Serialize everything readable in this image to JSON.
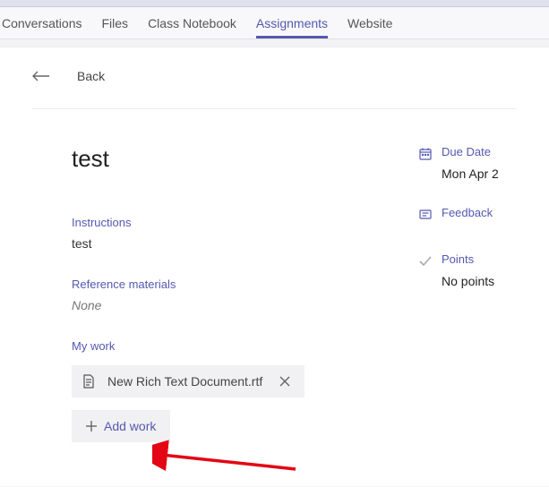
{
  "tabs": {
    "items": [
      {
        "label": "Conversations",
        "active": false
      },
      {
        "label": "Files",
        "active": false
      },
      {
        "label": "Class Notebook",
        "active": false
      },
      {
        "label": "Assignments",
        "active": true
      },
      {
        "label": "Website",
        "active": false
      }
    ]
  },
  "back": {
    "label": "Back"
  },
  "assignment": {
    "title": "test",
    "instructions_label": "Instructions",
    "instructions_value": "test",
    "reference_label": "Reference materials",
    "reference_value": "None",
    "mywork_label": "My work",
    "files": [
      {
        "name": "New Rich Text Document.rtf"
      }
    ],
    "addwork_label": "Add work"
  },
  "meta": {
    "due_label": "Due Date",
    "due_value": "Mon Apr 2",
    "feedback_label": "Feedback",
    "points_label": "Points",
    "points_value": "No points"
  }
}
